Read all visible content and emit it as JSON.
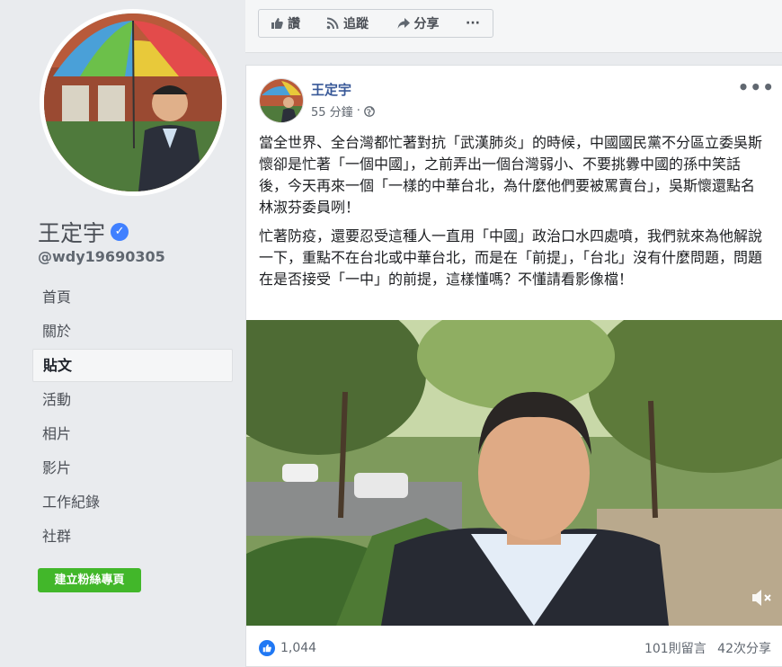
{
  "page": {
    "name": "王定宇",
    "handle": "@wdy19690305"
  },
  "sidebar": {
    "items": [
      {
        "label": "首頁"
      },
      {
        "label": "關於"
      },
      {
        "label": "貼文"
      },
      {
        "label": "活動"
      },
      {
        "label": "相片"
      },
      {
        "label": "影片"
      },
      {
        "label": "工作紀錄"
      },
      {
        "label": "社群"
      }
    ],
    "create_button": "建立粉絲專頁"
  },
  "actions": {
    "like": "讚",
    "follow": "追蹤",
    "share": "分享",
    "more": "···"
  },
  "post": {
    "author": "王定宇",
    "time": "55 分鐘",
    "paragraphs": [
      "當全世界、全台灣都忙著對抗「武漢肺炎」的時候，中國國民黨不分區立委吳斯懷卻是忙著「一個中國」，之前弄出一個台灣弱小、不要挑釁中國的孫中笑話後，今天再來一個「一樣的中華台北，為什麼他們要被罵賣台」，吳斯懷還點名林淑芬委員咧！",
      "忙著防疫，還要忍受這種人一直用「中國」政治口水四處噴，我們就來為他解說一下，重點不在台北或中華台北，而是在「前提」，「台北」沒有什麼問題，問題在是否接受「一中」的前提，這樣懂嗎？不懂請看影像檔！"
    ],
    "reactions": "1,044",
    "comments": "101則留言",
    "shares": "42次分享"
  }
}
